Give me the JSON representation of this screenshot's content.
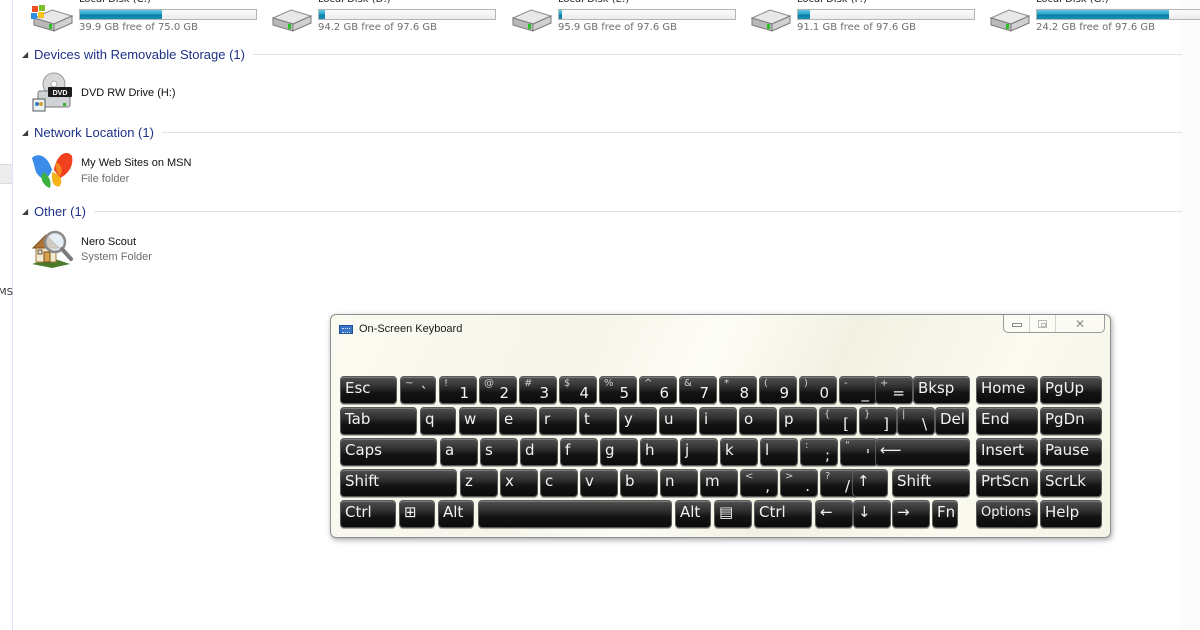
{
  "drives": [
    {
      "name": "Local Disk (C:)",
      "free_text": "39.9 GB free of 75.0 GB",
      "used_fraction": 0.468,
      "icon": "windows-drive-icon"
    },
    {
      "name": "Local Disk (D:)",
      "free_text": "94.2 GB free of 97.6 GB",
      "used_fraction": 0.035,
      "icon": "hard-drive-icon"
    },
    {
      "name": "Local Disk (E:)",
      "free_text": "95.9 GB free of 97.6 GB",
      "used_fraction": 0.017,
      "icon": "hard-drive-icon"
    },
    {
      "name": "Local Disk (F:)",
      "free_text": "91.1 GB free of 97.6 GB",
      "used_fraction": 0.067,
      "icon": "hard-drive-icon"
    },
    {
      "name": "Local Disk (G:)",
      "free_text": "24.2 GB free of 97.6 GB",
      "used_fraction": 0.752,
      "icon": "hard-drive-icon"
    }
  ],
  "groups": [
    {
      "title": "Devices with Removable Storage (1)",
      "items": [
        {
          "name": "DVD RW Drive (H:)",
          "sub": "",
          "icon": "dvd-drive-icon"
        }
      ]
    },
    {
      "title": "Network Location (1)",
      "items": [
        {
          "name": "My Web Sites on MSN",
          "sub": "File folder",
          "icon": "msn-butterfly-icon"
        }
      ]
    },
    {
      "title": "Other (1)",
      "items": [
        {
          "name": "Nero Scout",
          "sub": "System Folder",
          "icon": "nero-scout-icon"
        }
      ]
    }
  ],
  "nav_pane": {
    "truncated_text": "MS"
  },
  "osk": {
    "title": "On-Screen Keyboard",
    "controls": {
      "minimize": "minimize",
      "maximize": "maximize",
      "close": "close"
    },
    "rows": [
      [
        {
          "label": "Esc"
        },
        {
          "top": "~",
          "bottom": "`"
        },
        {
          "top": "!",
          "bottom": "1"
        },
        {
          "top": "@",
          "bottom": "2"
        },
        {
          "top": "#",
          "bottom": "3"
        },
        {
          "top": "$",
          "bottom": "4"
        },
        {
          "top": "%",
          "bottom": "5"
        },
        {
          "top": "^",
          "bottom": "6"
        },
        {
          "top": "&",
          "bottom": "7"
        },
        {
          "top": "*",
          "bottom": "8"
        },
        {
          "top": "(",
          "bottom": "9"
        },
        {
          "top": ")",
          "bottom": "0"
        },
        {
          "top": "-",
          "bottom": "_"
        },
        {
          "top": "+",
          "bottom": "="
        },
        {
          "label": "Bksp"
        },
        {
          "label": "Home"
        },
        {
          "label": "PgUp"
        }
      ],
      [
        {
          "label": "Tab"
        },
        {
          "label": "q"
        },
        {
          "label": "w"
        },
        {
          "label": "e"
        },
        {
          "label": "r"
        },
        {
          "label": "t"
        },
        {
          "label": "y"
        },
        {
          "label": "u"
        },
        {
          "label": "i"
        },
        {
          "label": "o"
        },
        {
          "label": "p"
        },
        {
          "top": "{",
          "bottom": "["
        },
        {
          "top": "}",
          "bottom": "]"
        },
        {
          "top": "|",
          "bottom": "\\"
        },
        {
          "label": "Del"
        },
        {
          "label": "End"
        },
        {
          "label": "PgDn"
        }
      ],
      [
        {
          "label": "Caps"
        },
        {
          "label": "a"
        },
        {
          "label": "s"
        },
        {
          "label": "d"
        },
        {
          "label": "f"
        },
        {
          "label": "g"
        },
        {
          "label": "h"
        },
        {
          "label": "j"
        },
        {
          "label": "k"
        },
        {
          "label": "l"
        },
        {
          "top": ":",
          "bottom": ";"
        },
        {
          "top": "\"",
          "bottom": "'"
        },
        {
          "label": "⟵"
        },
        {
          "label": "Insert"
        },
        {
          "label": "Pause"
        }
      ],
      [
        {
          "label": "Shift"
        },
        {
          "label": "z"
        },
        {
          "label": "x"
        },
        {
          "label": "c"
        },
        {
          "label": "v"
        },
        {
          "label": "b"
        },
        {
          "label": "n"
        },
        {
          "label": "m"
        },
        {
          "top": "<",
          "bottom": ","
        },
        {
          "top": ">",
          "bottom": "."
        },
        {
          "top": "?",
          "bottom": "/"
        },
        {
          "label": "↑"
        },
        {
          "label": "Shift"
        },
        {
          "label": "PrtScn"
        },
        {
          "label": "ScrLk"
        }
      ],
      [
        {
          "label": "Ctrl"
        },
        {
          "label": "⊞"
        },
        {
          "label": "Alt"
        },
        {
          "label": ""
        },
        {
          "label": "Alt"
        },
        {
          "label": "▤"
        },
        {
          "label": "Ctrl"
        },
        {
          "label": "←"
        },
        {
          "label": "↓"
        },
        {
          "label": "→"
        },
        {
          "label": "Fn"
        },
        {
          "label": "Options"
        },
        {
          "label": "Help"
        }
      ]
    ]
  }
}
